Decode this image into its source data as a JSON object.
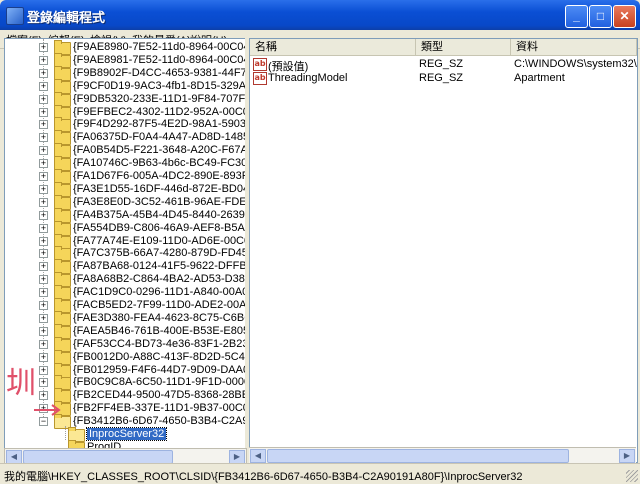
{
  "window": {
    "title": "登錄編輯程式"
  },
  "menu": [
    "檔案(F)",
    "編輯(E)",
    "檢視(V)",
    "我的最愛(A)",
    "說明(H)"
  ],
  "tree": {
    "keys": [
      "{F9AE8980-7E52-11d0-8964-00C04FD611",
      "{F9AE8981-7E52-11d0-8964-00C04FD611",
      "{F9B8902F-D4CC-4653-9381-44F7BFF3B",
      "{F9CF0D19-9AC3-4fb1-8D15-329A7A200",
      "{F9DB5320-233E-11D1-9F84-707F02C10",
      "{F9EFBEC2-4302-11D2-952A-00C04FA34",
      "{F9F4D292-87F5-4E2D-98A1-5903919324",
      "{FA06375D-F0A4-4A47-AD8D-148595F1E",
      "{FA0B54D5-F221-3648-A20C-F67A96F4A",
      "{FA10746C-9B63-4b6c-BC49-FC300EA5F",
      "{FA1D67F6-005A-4DC2-890E-893F8D35D",
      "{FA3E1D55-16DF-446d-872E-BD04D4F39",
      "{FA3E8E0D-3C52-461B-96AE-FDEE2583",
      "{FA4B375A-45B4-4D45-8440-263957B11",
      "{FA554DB9-C806-46A9-AEF8-B5AF891A",
      "{FA77A74E-E109-11D0-AD6E-00C04FD8",
      "{FA7C375B-66A7-4280-879D-FD459C84E",
      "{FA87BA68-0124-41F5-9622-DFFB46456",
      "{FA8A68B2-C864-4BA2-AD53-D3876A87",
      "{FAC1D9C0-0296-11D1-A840-00A0C92C",
      "{FACB5ED2-7F99-11D0-ADE2-00A0C90F",
      "{FAE3D380-FEA4-4623-8C75-C6B61110E",
      "{FAEA5B46-761B-400E-B53E-E805A97A",
      "{FAF53CC4-BD73-4e36-83F1-2B23F46E5",
      "{FB0012D0-A88C-413F-8D2D-5C4F0DEA",
      "{FB012959-F4F6-44D7-9D09-DAA087A9E",
      "{FB0C9C8A-6C50-11D1-9F1D-0000F8757",
      "{FB2CED44-9500-47D5-8368-28BE24AD",
      "{FB2FF4EB-337E-11D1-9B37-00C04FB95",
      "{FB3412B6-6D67-4650-B3B4-C2A90191A"
    ],
    "children": [
      "InprocServer32",
      "ProgID"
    ]
  },
  "list": {
    "headers": [
      "名稱",
      "類型",
      "資料"
    ],
    "rows": [
      {
        "name": "(預設值)",
        "type": "REG_SZ",
        "data": "C:\\WINDOWS\\system32\\xavsim"
      },
      {
        "name": "ThreadingModel",
        "type": "REG_SZ",
        "data": "Apartment"
      }
    ]
  },
  "status": "我的電腦\\HKEY_CLASSES_ROOT\\CLSID\\{FB3412B6-6D67-4650-B3B4-C2A90191A80F}\\InprocServer32",
  "annotation": {
    "text": "圳",
    "color": "#E0506A"
  }
}
